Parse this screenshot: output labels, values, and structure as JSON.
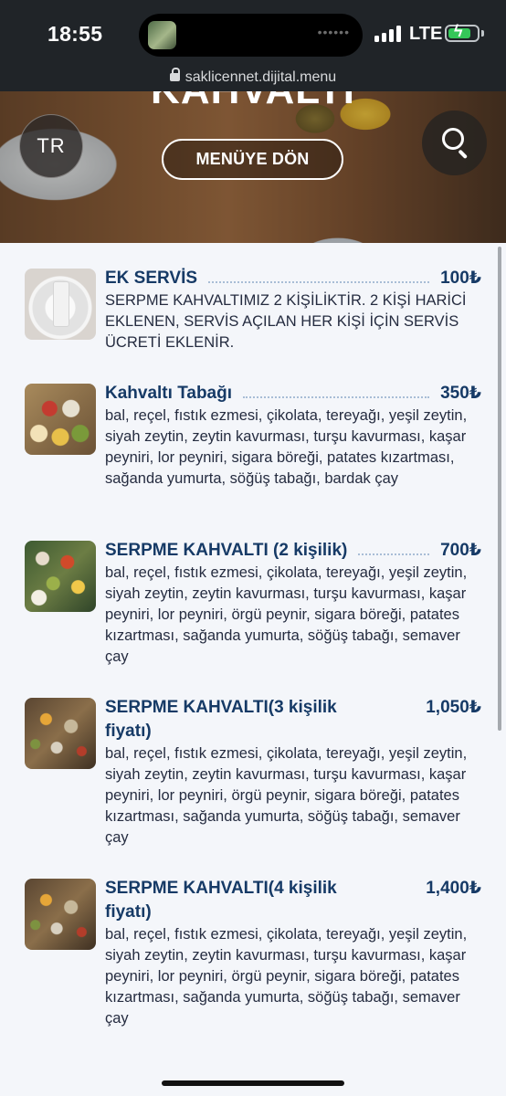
{
  "status_bar": {
    "time": "18:55",
    "network": "LTE",
    "battery_level": 0.8,
    "url": "saklicennet.dijital.menu"
  },
  "hero": {
    "title": "KAHVALTI",
    "language_button": "TR",
    "back_button": "MENÜYE DÖN",
    "search_icon": "search-icon"
  },
  "items": [
    {
      "name": "EK SERVİS",
      "price": "100₺",
      "description": "SERPME KAHVALTIMIZ 2 KİŞİLİKTİR. 2 KİŞİ HARİCİ EKLENEN, SERVİS AÇILAN HER KİŞİ İÇİN SERVİS ÜCRETİ EKLENİR."
    },
    {
      "name": "Kahvaltı Tabağı",
      "price": "350₺",
      "description": "bal, reçel, fıstık ezmesi, çikolata, tereyağı, yeşil zeytin, siyah zeytin, zeytin kavurması, turşu kavurması, kaşar peyniri, lor peyniri, sigara böreği, patates kızartması, sağanda yumurta, söğüş tabağı, bardak çay"
    },
    {
      "name": "SERPME KAHVALTI (2 kişilik)",
      "price": "700₺",
      "description": "bal, reçel, fıstık ezmesi, çikolata, tereyağı, yeşil zeytin, siyah zeytin, zeytin kavurması, turşu kavurması, kaşar peyniri, lor peyniri, örgü peynir, sigara böreği, patates kızartması, sağanda yumurta, söğüş tabağı, semaver çay"
    },
    {
      "name": "SERPME KAHVALTI(3 kişilik fiyatı)",
      "price": "1,050₺",
      "description": "bal, reçel, fıstık ezmesi, çikolata, tereyağı, yeşil zeytin, siyah zeytin, zeytin kavurması, turşu kavurması, kaşar peyniri, lor peyniri, örgü peynir, sigara böreği, patates kızartması, sağanda yumurta, söğüş tabağı, semaver çay"
    },
    {
      "name": "SERPME KAHVALTI(4 kişilik fiyatı)",
      "price": "1,400₺",
      "description": "bal, reçel, fıstık ezmesi, çikolata, tereyağı, yeşil zeytin, siyah zeytin, zeytin kavurması, turşu kavurması, kaşar peyniri, lor peyniri, örgü peynir, sigara böreği, patates kızartması, sağanda yumurta, söğüş tabağı, semaver çay"
    }
  ]
}
